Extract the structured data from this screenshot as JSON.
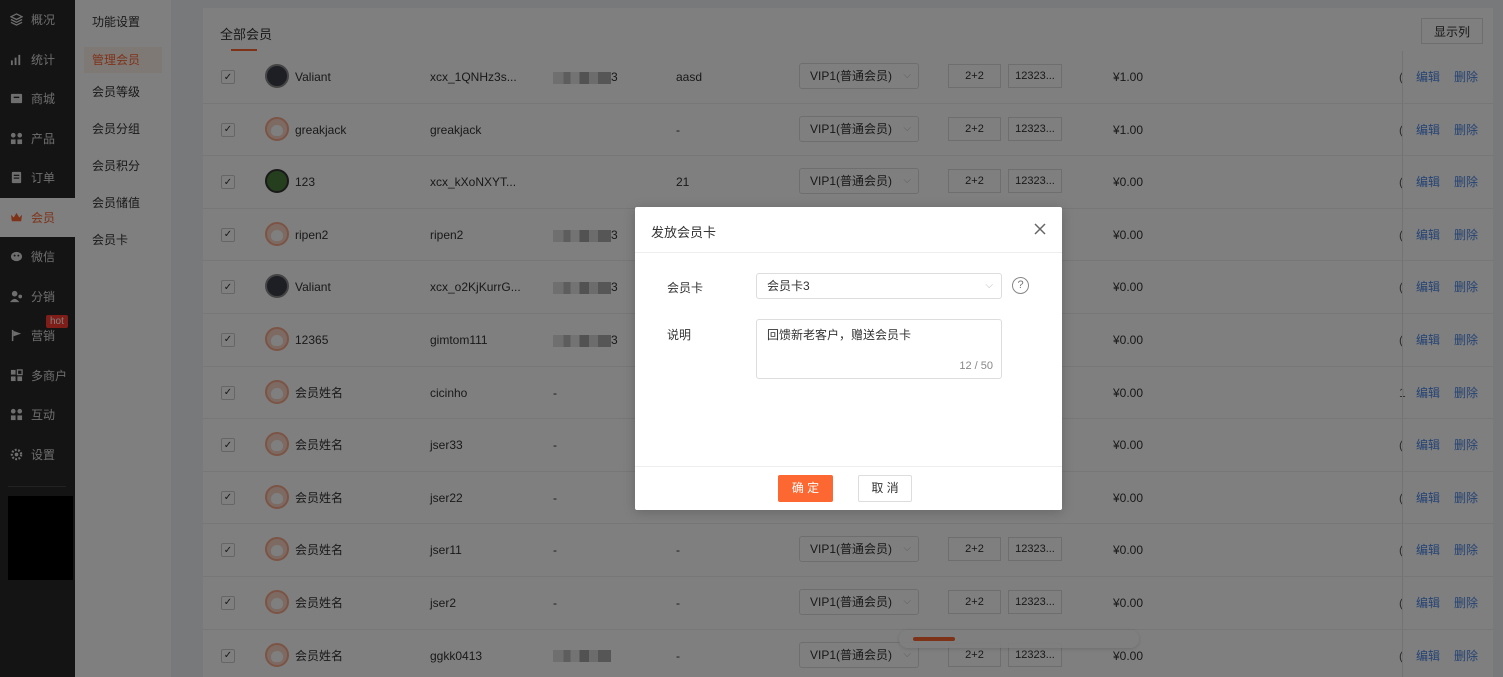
{
  "nav": {
    "items": [
      {
        "label": "概况",
        "icon": "layers-icon"
      },
      {
        "label": "统计",
        "icon": "chart-icon"
      },
      {
        "label": "商城",
        "icon": "store-icon"
      },
      {
        "label": "产品",
        "icon": "grid-icon"
      },
      {
        "label": "订单",
        "icon": "order-icon"
      },
      {
        "label": "会员",
        "icon": "crown-icon",
        "active": true
      },
      {
        "label": "微信",
        "icon": "wechat-icon"
      },
      {
        "label": "分销",
        "icon": "user-share-icon"
      },
      {
        "label": "营销",
        "icon": "flag-icon",
        "badge": "hot"
      },
      {
        "label": "多商户",
        "icon": "shop-icon"
      },
      {
        "label": "互动",
        "icon": "apps-icon"
      },
      {
        "label": "设置",
        "icon": "gear-icon"
      }
    ]
  },
  "submenu": {
    "items": [
      "功能设置",
      "管理会员",
      "会员等级",
      "会员分组",
      "会员积分",
      "会员储值",
      "会员卡"
    ],
    "active_index": 1
  },
  "main": {
    "tab": "全部会员",
    "columns_button": "显示列"
  },
  "table": {
    "rows": [
      {
        "name": "Valiant",
        "avatar": "dark",
        "account": "xcx_1QNHz3s...",
        "phone_suffix": "3",
        "phone_blur": true,
        "remark": "aasd",
        "level": "VIP1(普通会员)",
        "pts": "2+2",
        "pts2": "12323...",
        "money": "¥1.00",
        "trunc": "(",
        "edit": "编辑",
        "del": "删除"
      },
      {
        "name": "greakjack",
        "avatar": "default",
        "account": "greakjack",
        "phone_suffix": "",
        "phone_blur": false,
        "phone": "",
        "remark": "-",
        "level": "VIP1(普通会员)",
        "pts": "2+2",
        "pts2": "12323...",
        "money": "¥1.00",
        "trunc": "(",
        "edit": "编辑",
        "del": "删除"
      },
      {
        "name": "123",
        "avatar": "green",
        "account": "xcx_kXoNXYT...",
        "phone_suffix": "",
        "phone_blur": false,
        "phone": "",
        "remark": "21",
        "level": "VIP1(普通会员)",
        "pts": "2+2",
        "pts2": "12323...",
        "money": "¥0.00",
        "trunc": "(",
        "edit": "编辑",
        "del": "删除"
      },
      {
        "name": "ripen2",
        "avatar": "default",
        "account": "ripen2",
        "phone_suffix": "3",
        "phone_blur": true,
        "remark": "",
        "level": "",
        "pts": "",
        "pts2": "",
        "money": "¥0.00",
        "trunc": "(",
        "edit": "编辑",
        "del": "删除"
      },
      {
        "name": "Valiant",
        "avatar": "dark",
        "account": "xcx_o2KjKurrG...",
        "phone_suffix": "3",
        "phone_blur": true,
        "remark": "",
        "level": "",
        "pts": "",
        "pts2": "",
        "money": "¥0.00",
        "trunc": "(",
        "edit": "编辑",
        "del": "删除"
      },
      {
        "name": "12365",
        "avatar": "default",
        "account": "gimtom111",
        "phone_suffix": "3",
        "phone_blur": true,
        "remark": "",
        "level": "",
        "pts": "",
        "pts2": "",
        "money": "¥0.00",
        "trunc": "(",
        "edit": "编辑",
        "del": "删除"
      },
      {
        "name": "会员姓名",
        "avatar": "default",
        "account": "cicinho",
        "phone_suffix": "",
        "phone_blur": false,
        "phone": "-",
        "remark": "",
        "level": "",
        "pts": "",
        "pts2": "",
        "money": "¥0.00",
        "trunc": "1",
        "edit": "编辑",
        "del": "删除"
      },
      {
        "name": "会员姓名",
        "avatar": "default",
        "account": "jser33",
        "phone_suffix": "",
        "phone_blur": false,
        "phone": "-",
        "remark": "",
        "level": "",
        "pts": "",
        "pts2": "",
        "money": "¥0.00",
        "trunc": "(",
        "edit": "编辑",
        "del": "删除"
      },
      {
        "name": "会员姓名",
        "avatar": "default",
        "account": "jser22",
        "phone_suffix": "",
        "phone_blur": false,
        "phone": "-",
        "remark": "",
        "level": "",
        "pts": "",
        "pts2": "",
        "money": "¥0.00",
        "trunc": "(",
        "edit": "编辑",
        "del": "删除"
      },
      {
        "name": "会员姓名",
        "avatar": "default",
        "account": "jser11",
        "phone_suffix": "",
        "phone_blur": false,
        "phone": "-",
        "remark": "-",
        "level": "VIP1(普通会员)",
        "pts": "2+2",
        "pts2": "12323...",
        "money": "¥0.00",
        "trunc": "(",
        "edit": "编辑",
        "del": "删除"
      },
      {
        "name": "会员姓名",
        "avatar": "default",
        "account": "jser2",
        "phone_suffix": "",
        "phone_blur": false,
        "phone": "-",
        "remark": "-",
        "level": "VIP1(普通会员)",
        "pts": "2+2",
        "pts2": "12323...",
        "money": "¥0.00",
        "trunc": "(",
        "edit": "编辑",
        "del": "删除"
      },
      {
        "name": "会员姓名",
        "avatar": "default",
        "account": "ggkk0413",
        "phone_suffix": "",
        "phone_blur": true,
        "remark": "-",
        "level": "VIP1(普通会员)",
        "pts": "2+2",
        "pts2": "12323...",
        "money": "¥0.00",
        "trunc": "(",
        "edit": "编辑",
        "del": "删除"
      }
    ]
  },
  "dialog": {
    "title": "发放会员卡",
    "card_label": "会员卡",
    "card_value": "会员卡3",
    "help": "?",
    "desc_label": "说明",
    "desc_value": "回馈新老客户，赠送会员卡",
    "desc_count": "12 / 50",
    "ok": "确 定",
    "cancel": "取 消"
  },
  "colors": {
    "accent": "#fd6732",
    "link": "#4a86e8",
    "nav_bg": "#282828"
  }
}
